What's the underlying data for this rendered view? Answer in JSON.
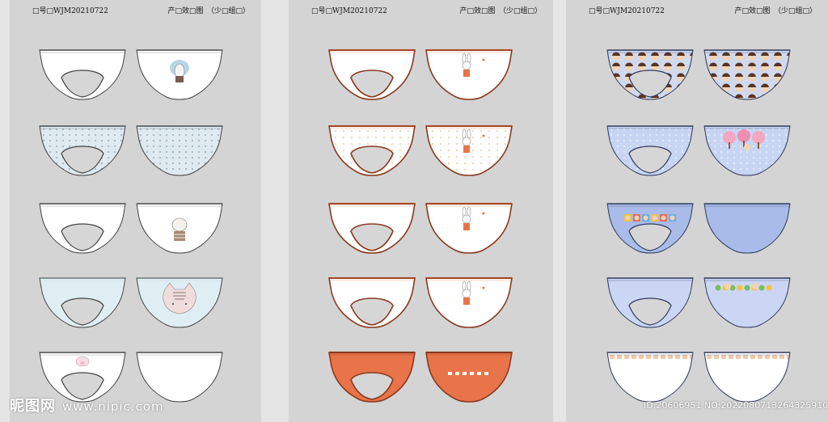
{
  "sheets": [
    {
      "code": "□号□WJM20210722",
      "title": "产□效□图　（少□组□）"
    },
    {
      "code": "□号□WJM20210722",
      "title": "产□效□图　（少□组□）"
    },
    {
      "code": "□号□WJM20210722",
      "title": "产□效□图　（少□组□）"
    }
  ],
  "colors": {
    "sheet_bg": "#d4d4d4",
    "gutter_bg": "#e5e5e5",
    "outline": "#333333",
    "orange": "#e9744a",
    "brown_trim": "#8a3a1e",
    "light_blue": "#cfd9f0",
    "mid_blue": "#a9bbe8",
    "pale_blue": "#e3eef3",
    "navy_trim": "#2e3a5c"
  },
  "watermark": {
    "brand": "昵图网",
    "url": "www.nipic.com"
  },
  "image_id": "ID:20606951 NO:20220807132643259106"
}
